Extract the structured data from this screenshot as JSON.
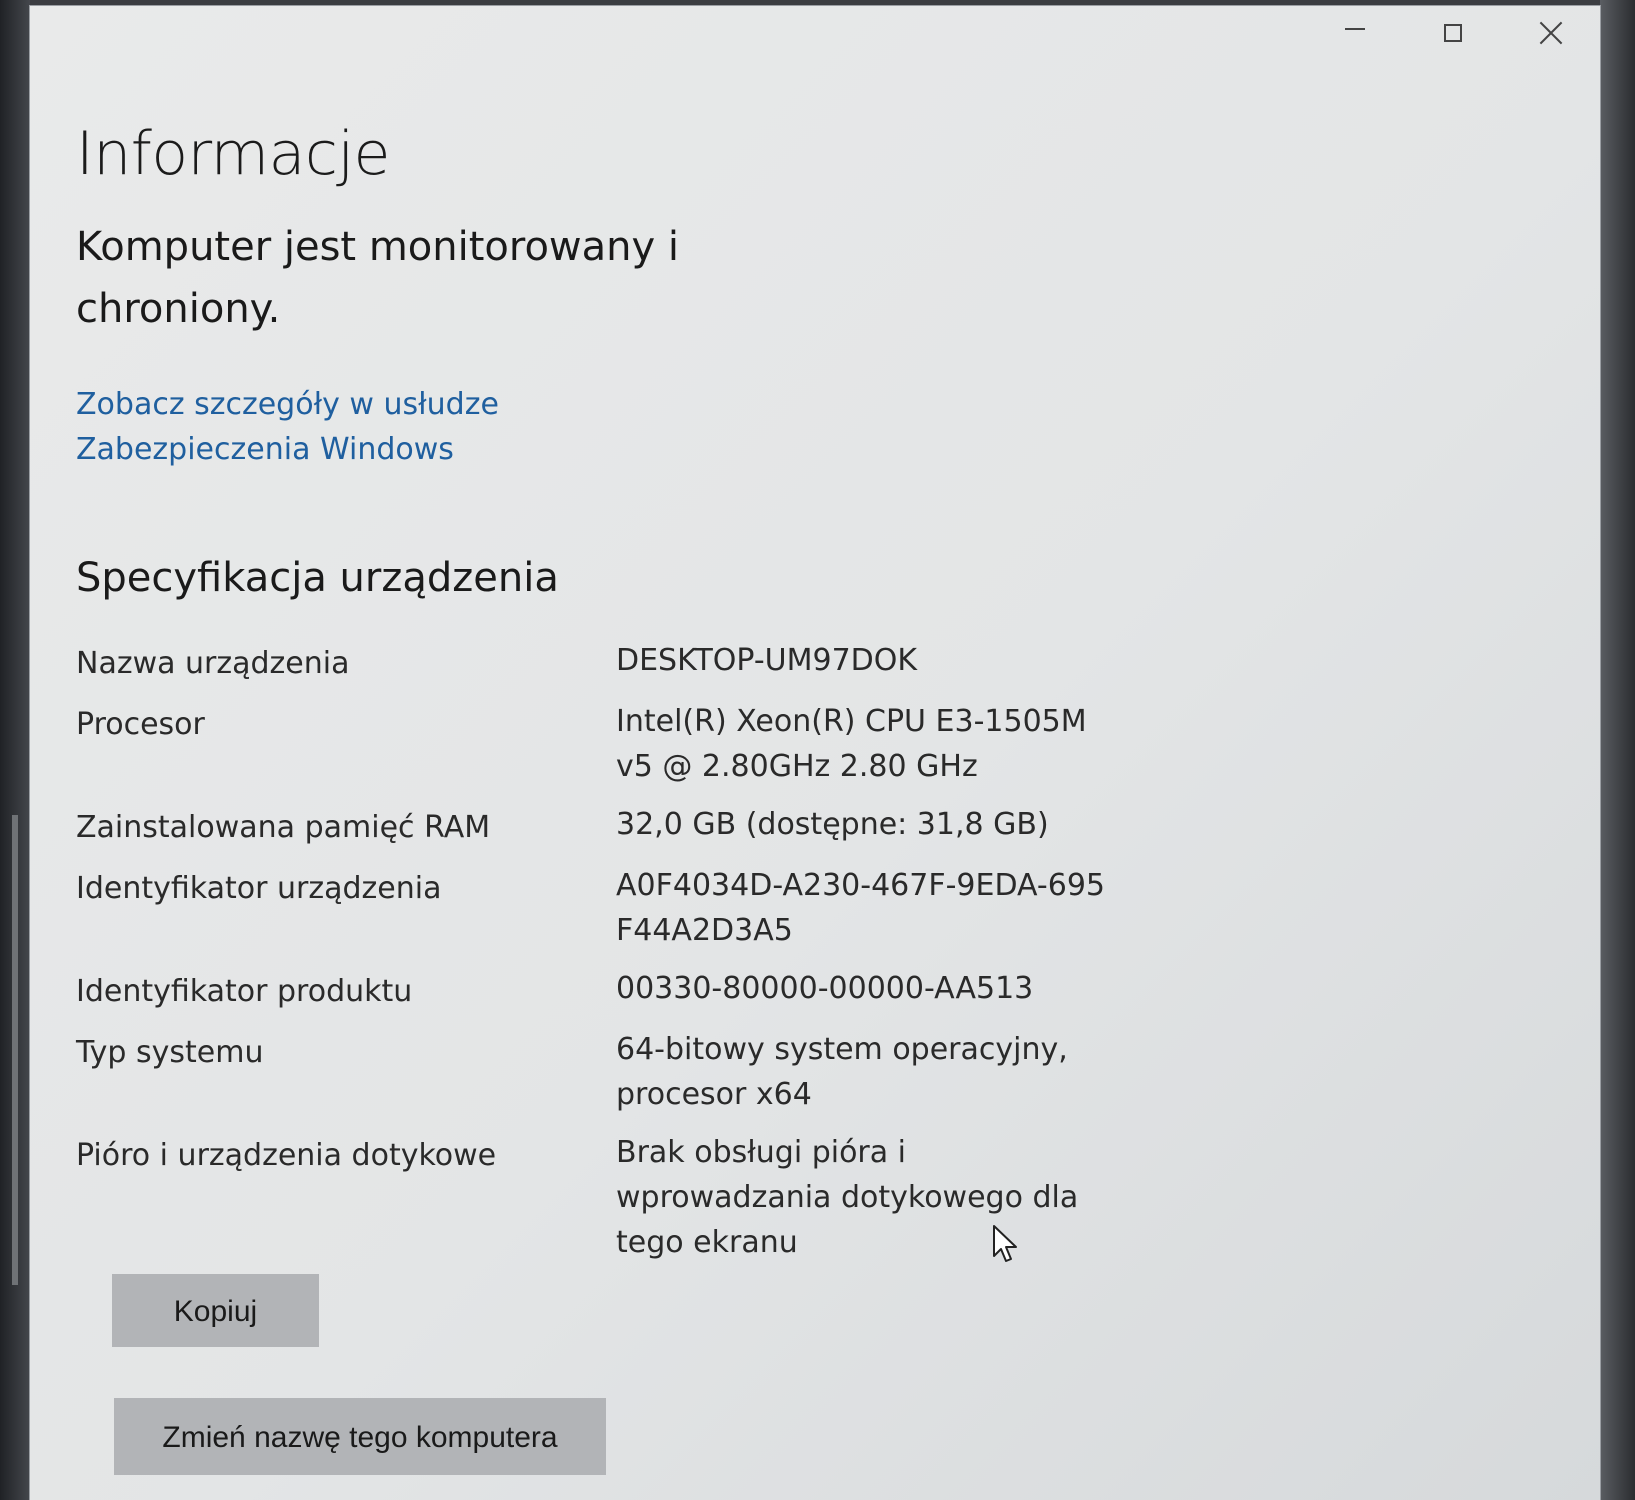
{
  "window": {
    "controls": {
      "minimize_icon": "minimize-icon",
      "maximize_icon": "maximize-icon",
      "close_icon": "close-icon"
    }
  },
  "page": {
    "title": "Informacje",
    "status_text": "Komputer jest monitorowany i chroniony.",
    "security_link": "Zobacz szczegóły w usłudze Zabezpieczenia Windows"
  },
  "specs": {
    "section_title": "Specyfikacja urządzenia",
    "rows": [
      {
        "label": "Nazwa urządzenia",
        "value": "DESKTOP-UM97DOK"
      },
      {
        "label": "Procesor",
        "value": "Intel(R) Xeon(R) CPU E3-1505M v5 @ 2.80GHz   2.80 GHz"
      },
      {
        "label": "Zainstalowana pamięć RAM",
        "value": "32,0 GB (dostępne: 31,8 GB)"
      },
      {
        "label": "Identyfikator urządzenia",
        "value": "A0F4034D-A230-467F-9EDA-695F44A2D3A5"
      },
      {
        "label": "Identyfikator produktu",
        "value": "00330-80000-00000-AA513"
      },
      {
        "label": "Typ systemu",
        "value": "64-bitowy system operacyjny, procesor x64"
      },
      {
        "label": "Pióro i urządzenia dotykowe",
        "value": "Brak obsługi pióra i wprowadzania dotykowego dla tego ekranu"
      }
    ]
  },
  "buttons": {
    "copy": "Kopiuj",
    "rename": "Zmień nazwę tego komputera"
  },
  "colors": {
    "link": "#1f5f9f",
    "button_bg": "#b2b4b7",
    "window_bg": "#e6e7e8"
  }
}
